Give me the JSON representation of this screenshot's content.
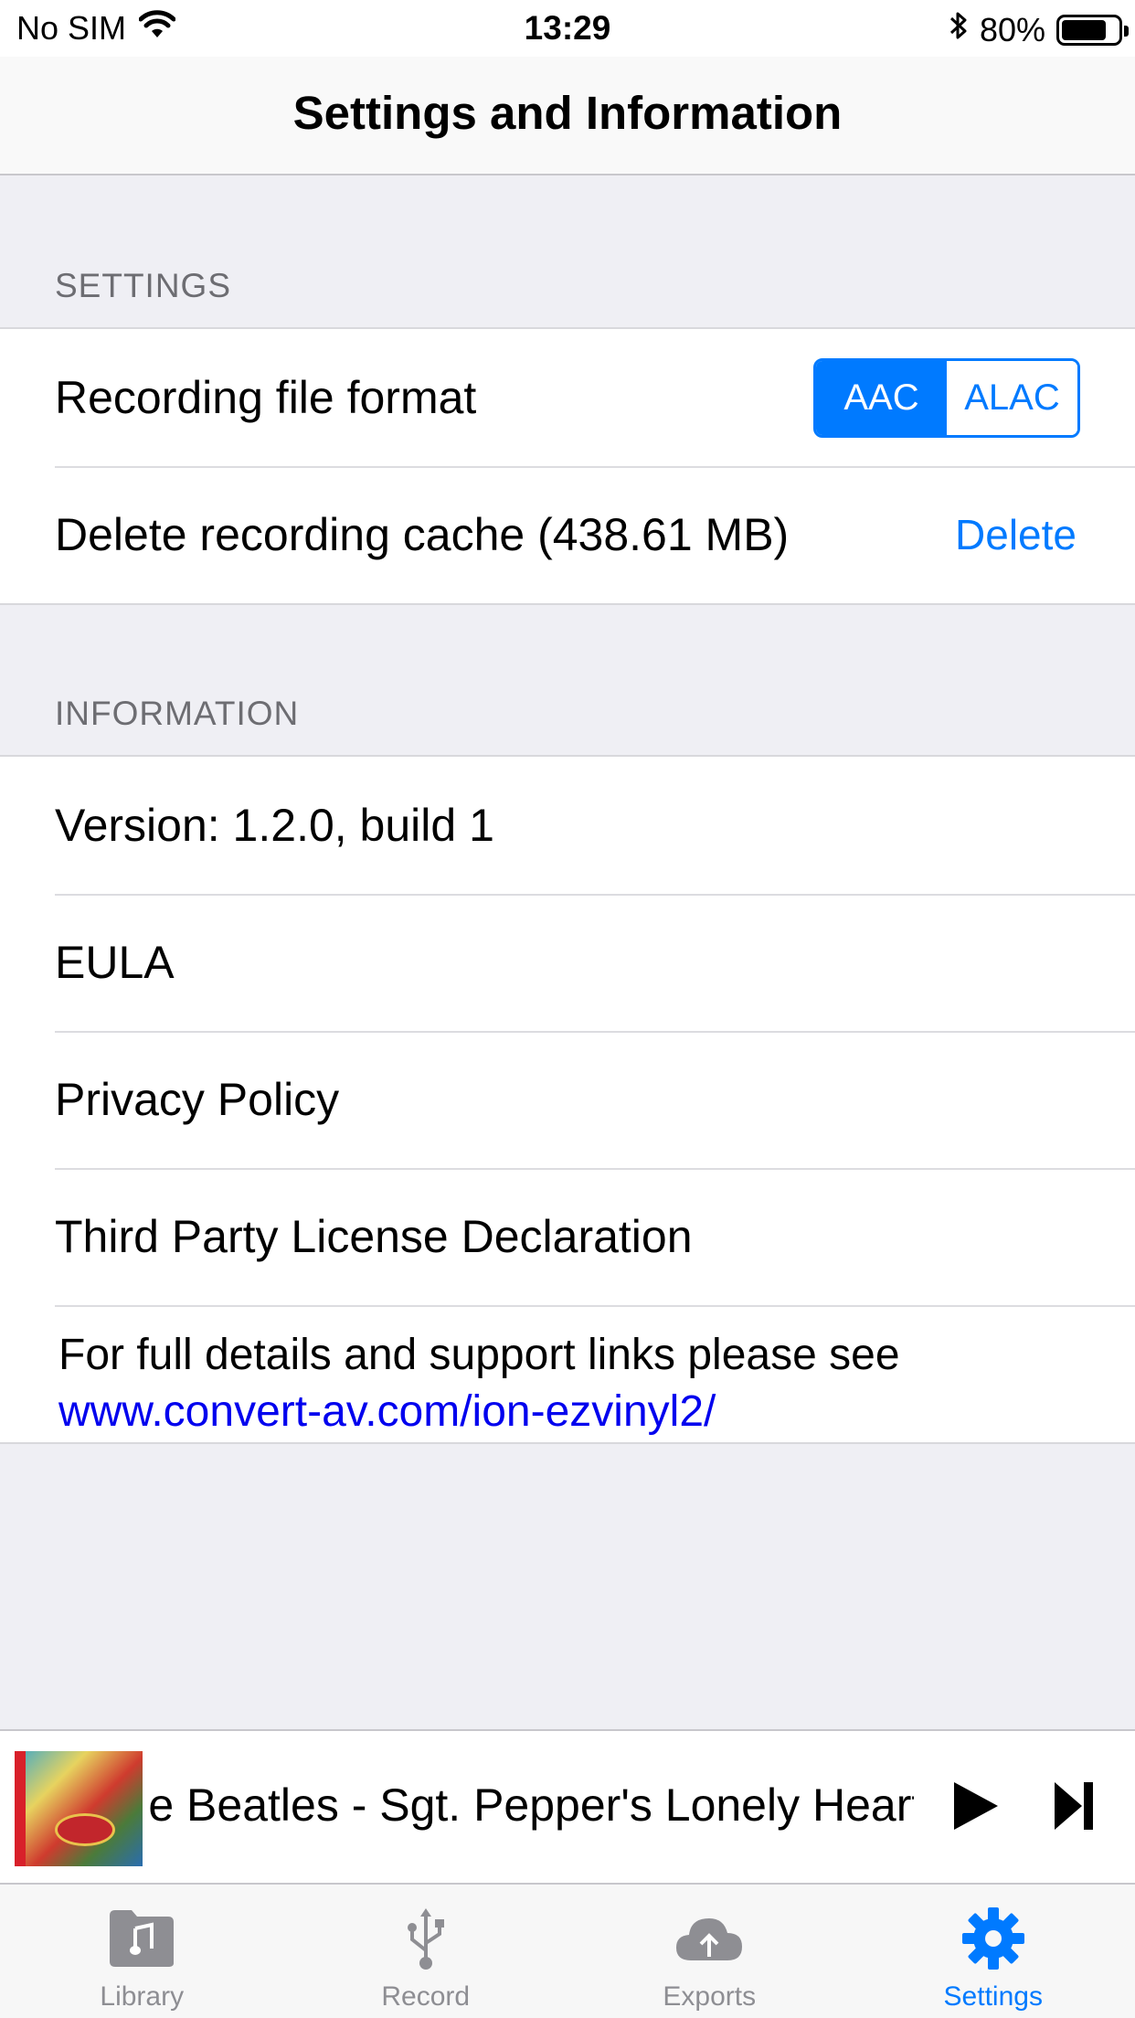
{
  "status_bar": {
    "carrier": "No SIM",
    "time": "13:29",
    "battery": "80%",
    "battery_level": 0.8
  },
  "nav": {
    "title": "Settings and Information"
  },
  "settings_section": {
    "header": "SETTINGS",
    "file_format_label": "Recording file format",
    "format_options": [
      "AAC",
      "ALAC"
    ],
    "selected_format": "AAC",
    "cache_label": "Delete recording cache (438.61 MB)",
    "delete_label": "Delete"
  },
  "information_section": {
    "header": "INFORMATION",
    "version": "Version: 1.2.0, build 1",
    "eula": "EULA",
    "privacy": "Privacy Policy",
    "third_party": "Third Party License Declaration",
    "support_text": "For full details and support links please see",
    "support_link": "www.convert-av.com/ion-ezvinyl2/"
  },
  "player": {
    "track": "The Beatles - Sgt. Pepper's Lonely Hearts C"
  },
  "tabs": [
    {
      "label": "Library",
      "icon": "library-folder-icon",
      "active": false
    },
    {
      "label": "Record",
      "icon": "usb-icon",
      "active": false
    },
    {
      "label": "Exports",
      "icon": "cloud-upload-icon",
      "active": false
    },
    {
      "label": "Settings",
      "icon": "gear-icon",
      "active": true
    }
  ],
  "colors": {
    "accent": "#007aff",
    "link": "#0000ee",
    "background": "#efeff4",
    "inactive_tab": "#8e8e93"
  }
}
